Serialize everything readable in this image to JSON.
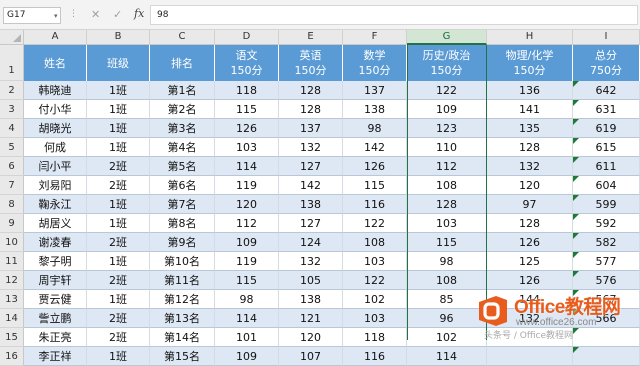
{
  "formula_bar": {
    "name_box": "G17",
    "cancel_icon": "✕",
    "enter_icon": "✓",
    "fx_label": "fx",
    "formula_value": "98"
  },
  "columns": [
    "A",
    "B",
    "C",
    "D",
    "E",
    "F",
    "G",
    "H",
    "I"
  ],
  "selected_column": "G",
  "header": {
    "row_number": "1",
    "cells": [
      "姓名",
      "班级",
      "排名",
      "语文\n150分",
      "英语\n150分",
      "数学\n150分",
      "历史/政治\n150分",
      "物理/化学\n150分",
      "总分\n750分"
    ]
  },
  "rows": [
    {
      "n": "2",
      "cells": [
        "韩晓迪",
        "1班",
        "第1名",
        "118",
        "128",
        "137",
        "122",
        "136",
        "642"
      ]
    },
    {
      "n": "3",
      "cells": [
        "付小华",
        "1班",
        "第2名",
        "115",
        "128",
        "138",
        "109",
        "141",
        "631"
      ]
    },
    {
      "n": "4",
      "cells": [
        "胡晓光",
        "1班",
        "第3名",
        "126",
        "137",
        "98",
        "123",
        "135",
        "619"
      ]
    },
    {
      "n": "5",
      "cells": [
        "何成",
        "1班",
        "第4名",
        "103",
        "132",
        "142",
        "110",
        "128",
        "615"
      ]
    },
    {
      "n": "6",
      "cells": [
        "闫小平",
        "2班",
        "第5名",
        "114",
        "127",
        "126",
        "112",
        "132",
        "611"
      ]
    },
    {
      "n": "7",
      "cells": [
        "刘易阳",
        "2班",
        "第6名",
        "119",
        "142",
        "115",
        "108",
        "120",
        "604"
      ]
    },
    {
      "n": "8",
      "cells": [
        "鞠永江",
        "1班",
        "第7名",
        "120",
        "138",
        "116",
        "128",
        "97",
        "599"
      ]
    },
    {
      "n": "9",
      "cells": [
        "胡居义",
        "1班",
        "第8名",
        "112",
        "127",
        "122",
        "103",
        "128",
        "592"
      ]
    },
    {
      "n": "10",
      "cells": [
        "谢凌春",
        "2班",
        "第9名",
        "109",
        "124",
        "108",
        "115",
        "126",
        "582"
      ]
    },
    {
      "n": "11",
      "cells": [
        "黎子明",
        "1班",
        "第10名",
        "119",
        "132",
        "103",
        "98",
        "125",
        "577"
      ]
    },
    {
      "n": "12",
      "cells": [
        "周宇轩",
        "2班",
        "第11名",
        "115",
        "105",
        "122",
        "108",
        "126",
        "576"
      ]
    },
    {
      "n": "13",
      "cells": [
        "贾云健",
        "1班",
        "第12名",
        "98",
        "138",
        "102",
        "85",
        "144",
        "567"
      ]
    },
    {
      "n": "14",
      "cells": [
        "訾立鹏",
        "2班",
        "第13名",
        "114",
        "121",
        "103",
        "96",
        "132",
        "566"
      ]
    },
    {
      "n": "15",
      "cells": [
        "朱正亮",
        "2班",
        "第14名",
        "101",
        "120",
        "118",
        "102",
        "",
        ""
      ]
    },
    {
      "n": "16",
      "cells": [
        "李正祥",
        "1班",
        "第15名",
        "109",
        "107",
        "116",
        "114",
        "",
        ""
      ]
    }
  ],
  "watermark": {
    "title": "Office教程网",
    "url": "www.office26.com",
    "sub": "头条号 / Office教程网"
  },
  "colors": {
    "header_blue": "#5b9bd5",
    "band_blue": "#dde8f4",
    "selection_green": "#217346",
    "error_indicator": "#1e7b37"
  }
}
